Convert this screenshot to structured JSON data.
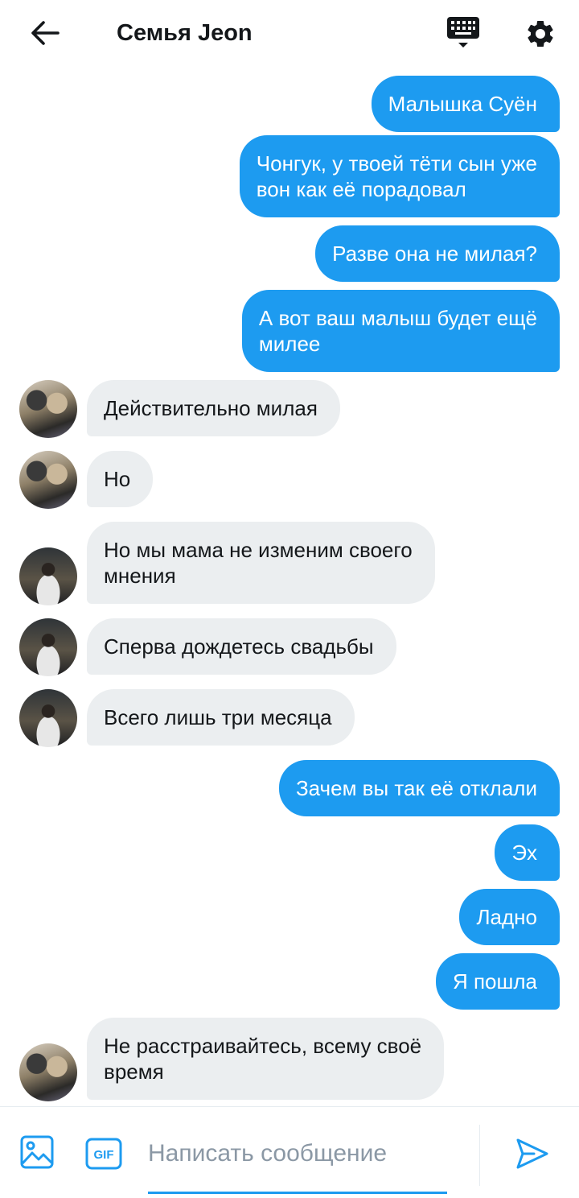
{
  "header": {
    "title": "Семья Jeon",
    "icons": {
      "back": "arrow-left-icon",
      "keyboard": "keyboard-icon",
      "settings": "gear-icon"
    }
  },
  "messages": [
    {
      "dir": "out",
      "text": "Малышка Суён"
    },
    {
      "dir": "out",
      "text": "Чонгук, у твоей тёти сын уже\nвон как её порадовал"
    },
    {
      "dir": "out",
      "text": "Разве она не милая?"
    },
    {
      "dir": "out",
      "text": "А вот ваш малыш будет ещё\nмилее"
    },
    {
      "dir": "in",
      "avatar": "a1",
      "text": "Действительно милая"
    },
    {
      "dir": "in",
      "avatar": "a1",
      "text": "Но"
    },
    {
      "dir": "in",
      "avatar": "a2",
      "text": "Но мы мама не изменим своего\nмнения"
    },
    {
      "dir": "in",
      "avatar": "a2",
      "text": "Сперва дождетесь свадьбы"
    },
    {
      "dir": "in",
      "avatar": "a2",
      "text": "Всего лишь три месяца"
    },
    {
      "dir": "out",
      "text": "Зачем вы так её отклали"
    },
    {
      "dir": "out",
      "text": "Эх"
    },
    {
      "dir": "out",
      "text": "Ладно"
    },
    {
      "dir": "out",
      "text": "Я пошла"
    },
    {
      "dir": "in",
      "avatar": "a1",
      "text": "Не расстраивайтесь, всему своё\nвремя"
    }
  ],
  "composer": {
    "placeholder": "Написать сообщение",
    "gif_label": "GIF",
    "icons": {
      "image": "image-icon",
      "gif": "gif-icon",
      "send": "send-icon"
    }
  },
  "colors": {
    "accent": "#1d9bf0",
    "incoming_bubble": "#ebeef0"
  }
}
